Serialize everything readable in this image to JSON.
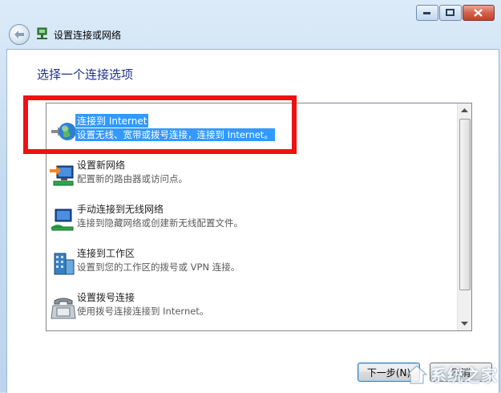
{
  "window": {
    "title": "设置连接或网络",
    "controls": [
      "minimize",
      "maximize",
      "close"
    ]
  },
  "page": {
    "heading": "选择一个连接选项"
  },
  "options": [
    {
      "title": "连接到 Internet",
      "desc": "设置无线、宽带或拨号连接，连接到 Internet。",
      "icon": "globe-icon",
      "selected": true
    },
    {
      "title": "设置新网络",
      "desc": "配置新的路由器或访问点。",
      "icon": "new-network-icon",
      "selected": false
    },
    {
      "title": "手动连接到无线网络",
      "desc": "连接到隐藏网络或创建新无线配置文件。",
      "icon": "wireless-network-icon",
      "selected": false
    },
    {
      "title": "连接到工作区",
      "desc": "设置到您的工作区的拨号或 VPN 连接。",
      "icon": "workplace-icon",
      "selected": false
    },
    {
      "title": "设置拨号连接",
      "desc": "使用拨号连接连接到 Internet。",
      "icon": "dialup-phone-icon",
      "selected": false
    }
  ],
  "buttons": {
    "next": "下一步(N)",
    "cancel": "取消"
  },
  "watermark": {
    "text": "系统之家"
  },
  "colors": {
    "selection": "#3399ff",
    "highlight_box": "#ee1111",
    "heading": "#1e3287"
  }
}
